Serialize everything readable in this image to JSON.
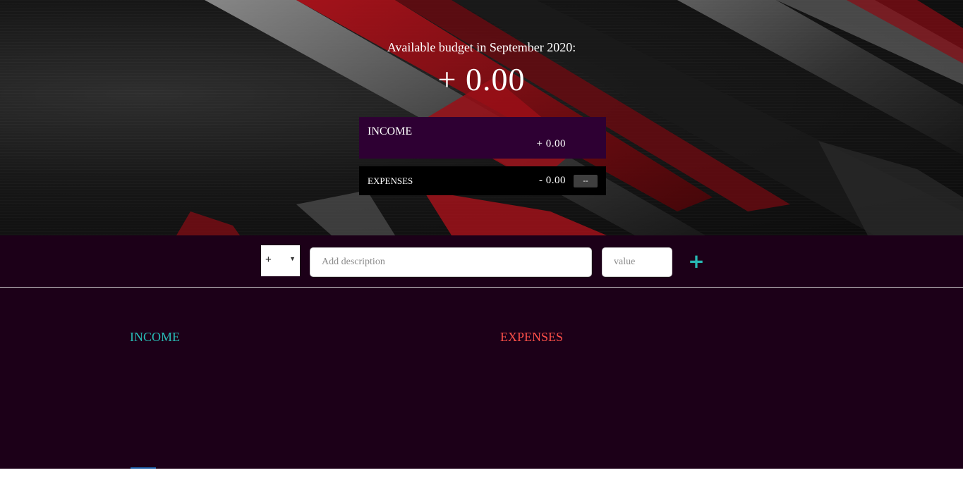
{
  "budget": {
    "title": "Available budget in September 2020:",
    "value": "+ 0.00"
  },
  "income_card": {
    "label": "INCOME",
    "value": "+ 0.00"
  },
  "expenses_card": {
    "label": "EXPENSES",
    "value": "- 0.00",
    "percentage": "--"
  },
  "add_form": {
    "type_value": "+",
    "description_placeholder": "Add description",
    "value_placeholder": "value",
    "add_symbol": "+"
  },
  "lists": {
    "income_title": "INCOME",
    "expenses_title": "EXPENSES"
  },
  "colors": {
    "income_accent": "#28b9b5",
    "expenses_accent": "#ff5049",
    "income_card_bg": "#2e0033",
    "panel_bg": "#1c0018"
  }
}
